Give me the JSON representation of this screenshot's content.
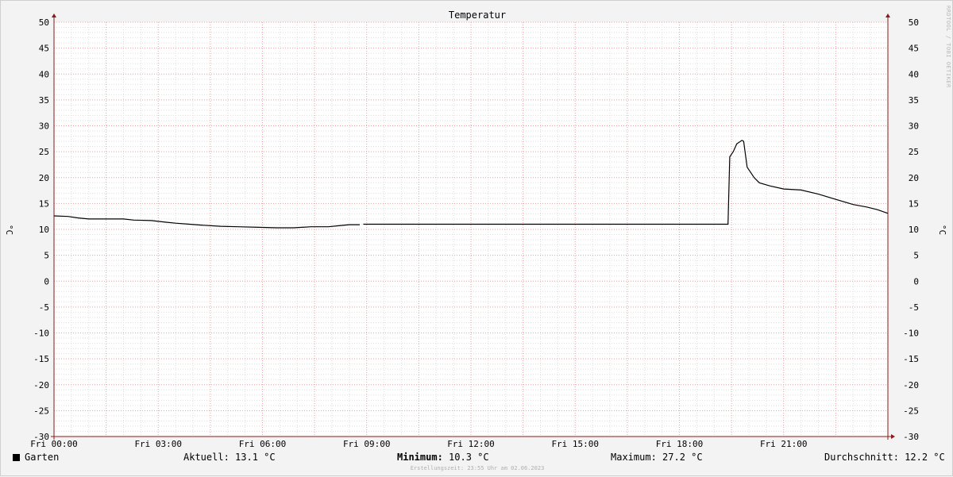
{
  "chart_data": {
    "type": "line",
    "title": "Temperatur",
    "ylabel": "°C",
    "ylim": [
      -30,
      50
    ],
    "yticks": [
      50,
      45,
      40,
      35,
      30,
      25,
      20,
      15,
      10,
      5,
      0,
      -5,
      -10,
      -15,
      -20,
      -25,
      -30
    ],
    "xlim": [
      0,
      24
    ],
    "xticks": [
      {
        "h": 0,
        "label": "Fri 00:00"
      },
      {
        "h": 3,
        "label": "Fri 03:00"
      },
      {
        "h": 6,
        "label": "Fri 06:00"
      },
      {
        "h": 9,
        "label": "Fri 09:00"
      },
      {
        "h": 12,
        "label": "Fri 12:00"
      },
      {
        "h": 15,
        "label": "Fri 15:00"
      },
      {
        "h": 18,
        "label": "Fri 18:00"
      },
      {
        "h": 21,
        "label": "Fri 21:00"
      }
    ],
    "grid": true,
    "series": [
      {
        "name": "Garten",
        "color": "#000000",
        "segments": [
          [
            [
              0,
              12.6
            ],
            [
              0.4,
              12.5
            ],
            [
              0.7,
              12.2
            ],
            [
              1.0,
              12.0
            ],
            [
              1.5,
              12.0
            ],
            [
              2.0,
              12.0
            ],
            [
              2.3,
              11.8
            ],
            [
              2.8,
              11.7
            ],
            [
              3.2,
              11.4
            ],
            [
              3.5,
              11.2
            ],
            [
              3.9,
              11.0
            ],
            [
              4.3,
              10.8
            ],
            [
              4.8,
              10.6
            ],
            [
              5.3,
              10.5
            ],
            [
              5.9,
              10.4
            ],
            [
              6.4,
              10.3
            ],
            [
              6.9,
              10.3
            ],
            [
              7.4,
              10.5
            ],
            [
              7.9,
              10.5
            ],
            [
              8.2,
              10.7
            ],
            [
              8.5,
              10.9
            ],
            [
              8.8,
              10.9
            ]
          ],
          [
            [
              8.9,
              11.0
            ],
            [
              10.0,
              11.0
            ],
            [
              12.0,
              11.0
            ],
            [
              14.0,
              11.0
            ],
            [
              16.0,
              11.0
            ],
            [
              18.0,
              11.0
            ],
            [
              19.4,
              11.0
            ],
            [
              19.45,
              24.0
            ],
            [
              19.55,
              25.0
            ],
            [
              19.65,
              26.5
            ],
            [
              19.8,
              27.2
            ],
            [
              19.85,
              27.0
            ],
            [
              19.9,
              24.5
            ],
            [
              19.95,
              22.0
            ],
            [
              20.05,
              21.0
            ],
            [
              20.15,
              20.0
            ],
            [
              20.3,
              19.0
            ],
            [
              20.6,
              18.4
            ],
            [
              21.0,
              17.8
            ],
            [
              21.5,
              17.6
            ],
            [
              22.0,
              16.8
            ],
            [
              22.5,
              15.8
            ],
            [
              23.0,
              14.8
            ],
            [
              23.4,
              14.3
            ],
            [
              23.7,
              13.8
            ],
            [
              24.0,
              13.1
            ]
          ]
        ]
      }
    ]
  },
  "legend": {
    "series_name": "Garten",
    "current": "Aktuell: 13.1 °C",
    "minimum_label": "Minimum:",
    "minimum_value": "10.3 °C",
    "maximum": "Maximum: 27.2 °C",
    "average": "Durchschnitt: 12.2 °C"
  },
  "footer": "Erstellungszeit: 23:55 Uhr am 02.06.2023",
  "watermark": "RRDTOOL / TOBI OETIKER",
  "colors": {
    "background": "#f3f3f3",
    "plot_bg": "#ffffff",
    "minor_grid": "#dedede",
    "major_grid": "#e8a0a0",
    "axis": "#8b1a1a",
    "line": "#000000"
  }
}
